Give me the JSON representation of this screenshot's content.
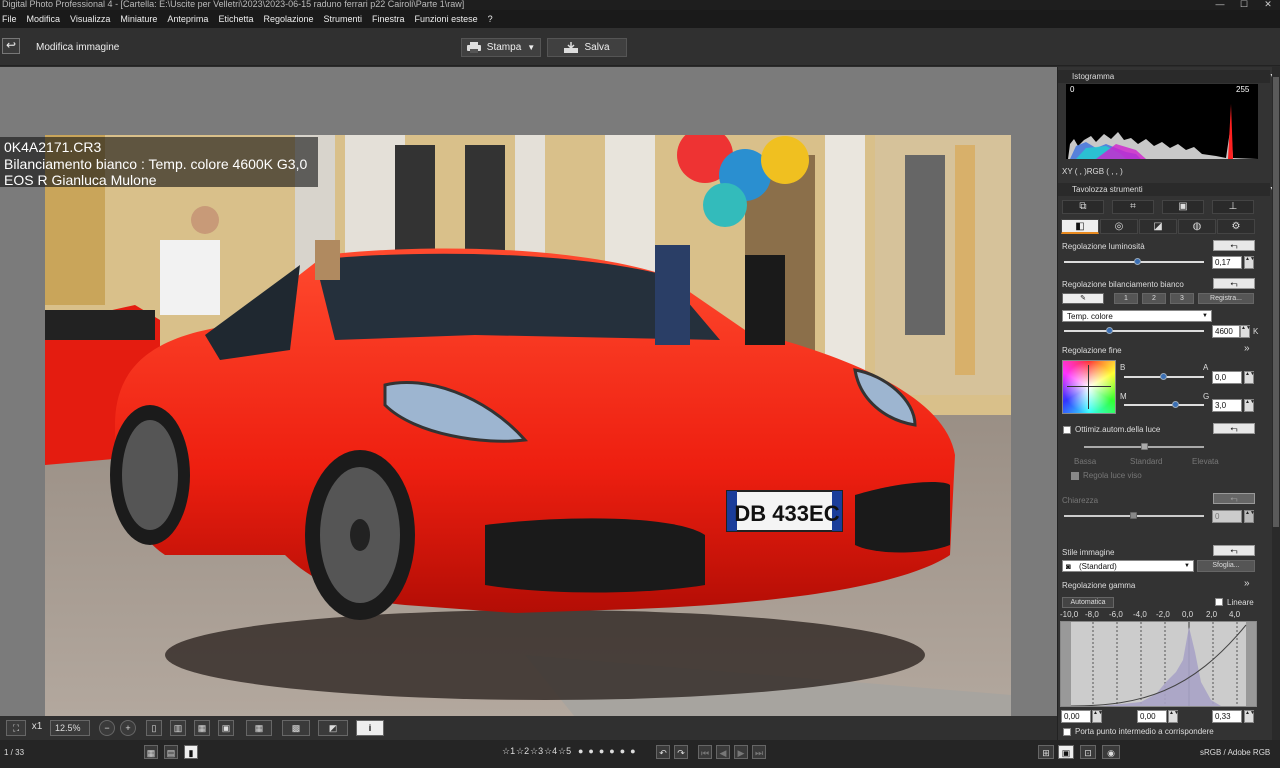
{
  "window": {
    "title": "Digital Photo Professional 4 - [Cartella: E:\\Uscite per Velletri\\2023\\2023-06-15 raduno ferrari p22 Cairoli\\Parte 1\\raw]",
    "minimize": "—",
    "maximize": "☐",
    "close": "✕"
  },
  "menu": [
    "File",
    "Modifica",
    "Visualizza",
    "Miniature",
    "Anteprima",
    "Etichetta",
    "Regolazione",
    "Strumenti",
    "Finestra",
    "Funzioni estese",
    "?"
  ],
  "toolbar": {
    "back_icon": "↩",
    "title": "Modifica immagine",
    "print_label": "Stampa",
    "save_label": "Salva"
  },
  "image_info": {
    "filename": "0K4A2171.CR3",
    "white_balance": "Bilanciamento bianco : Temp. colore 4600K G3,0",
    "camera_owner": "EOS R Gianluca Mulone"
  },
  "plate": {
    "text": "DB 433EC"
  },
  "viewbar": {
    "zoom_ratio": "x1",
    "zoom": "12.5%",
    "zoom_out": "−",
    "zoom_in": "+",
    "info_icon": "i"
  },
  "statusbar": {
    "counter": "1 / 33",
    "ratings": [
      "☆1",
      "☆2",
      "☆3",
      "☆4",
      "☆5"
    ],
    "colorspace": "sRGB / Adobe RGB"
  },
  "histogram": {
    "title": "Istogramma",
    "min": "0",
    "max": "255",
    "readout": "XY (   ,   )RGB (   ,   ,   )"
  },
  "tools": {
    "title": "Tavolozza strumenti",
    "brightness": {
      "label": "Regolazione luminosità",
      "value": "0,17"
    },
    "white_balance": {
      "label": "Regolazione bilanciamento bianco",
      "btn1": "1",
      "btn2": "2",
      "btn3": "3",
      "register": "Registra...",
      "mode": "Temp. colore",
      "temp_value": "4600",
      "unit": "K"
    },
    "fine": {
      "label": "Regolazione fine",
      "b": "B",
      "a": "A",
      "m": "M",
      "g": "G",
      "ba_value": "0,0",
      "mg_value": "3,0"
    },
    "auto_light": {
      "label": "Ottimiz.autom.della luce",
      "low": "Bassa",
      "standard": "Standard",
      "high": "Elevata",
      "face": "Regola luce viso"
    },
    "clarity": {
      "label": "Chiarezza",
      "value": "0"
    },
    "picture_style": {
      "label": "Stile immagine",
      "value": "(Standard)",
      "browse": "Sfoglia..."
    },
    "gamma": {
      "label": "Regolazione gamma",
      "auto": "Automatica",
      "linear": "Lineare",
      "scale": [
        "-10,0",
        "-8,0",
        "-6,0",
        "-4,0",
        "-2,0",
        "0,0",
        "2,0",
        "4,0"
      ],
      "low": "0,00",
      "mid": "0,00",
      "high": "0,33",
      "midpoint": "Porta punto intermedio a corrispondere"
    }
  }
}
